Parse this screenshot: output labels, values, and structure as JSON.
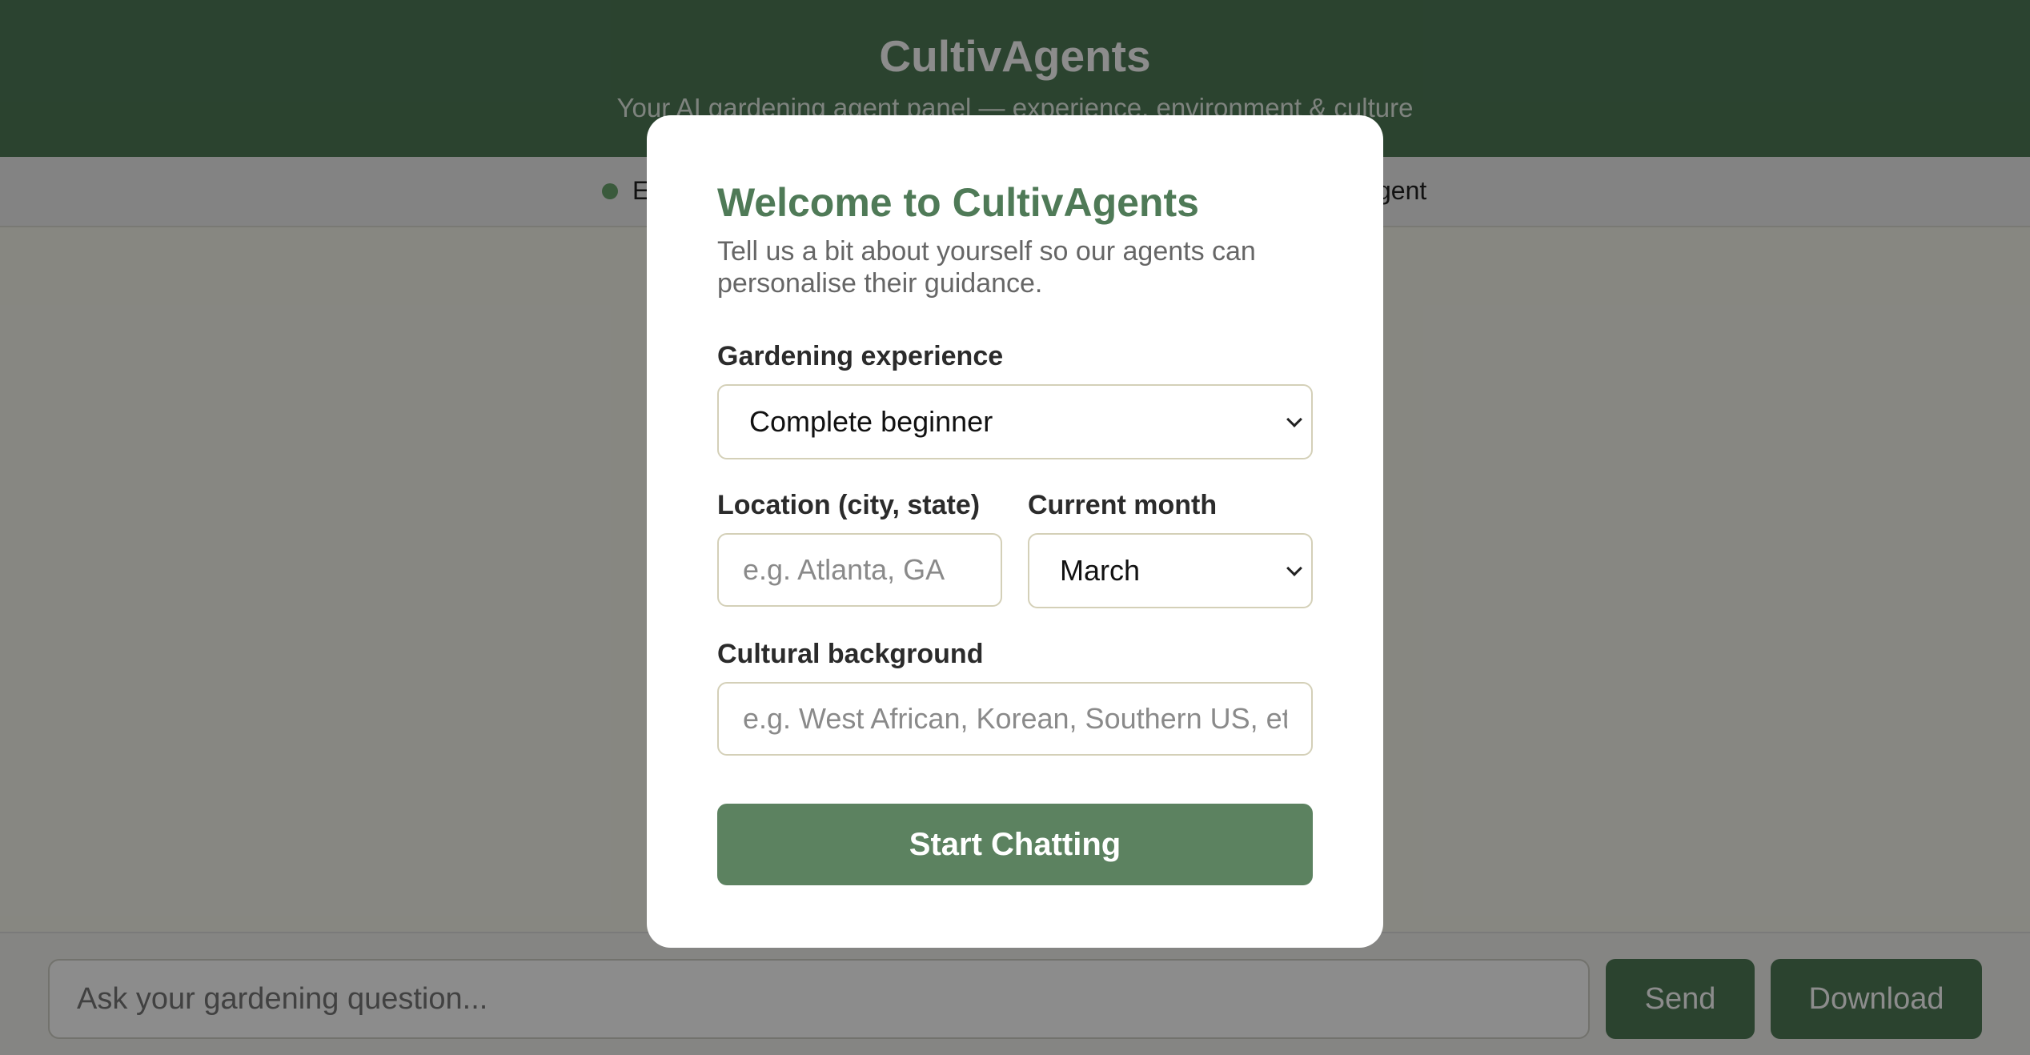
{
  "app": {
    "title": "CultivAgents",
    "subtitle": "Your AI gardening agent panel — experience, environment & culture"
  },
  "agent_bar": {
    "items": [
      {
        "label": "E"
      },
      {
        "label": "gent"
      }
    ]
  },
  "chat": {
    "input_placeholder": "Ask your gardening question...",
    "send_label": "Send",
    "download_label": "Download"
  },
  "modal": {
    "title": "Welcome to CultivAgents",
    "description": "Tell us a bit about yourself so our agents can personalise their guidance.",
    "experience": {
      "label": "Gardening experience",
      "value": "Complete beginner"
    },
    "location": {
      "label": "Location (city, state)",
      "placeholder": "e.g. Atlanta, GA"
    },
    "month": {
      "label": "Current month",
      "value": "March"
    },
    "culture": {
      "label": "Cultural background",
      "placeholder": "e.g. West African, Korean, Southern US, etc."
    },
    "start_label": "Start Chatting"
  },
  "colors": {
    "brand_green": "#4f7a57",
    "button_green": "#5c8260",
    "overlay": "rgba(0,0,0,0.45)"
  }
}
